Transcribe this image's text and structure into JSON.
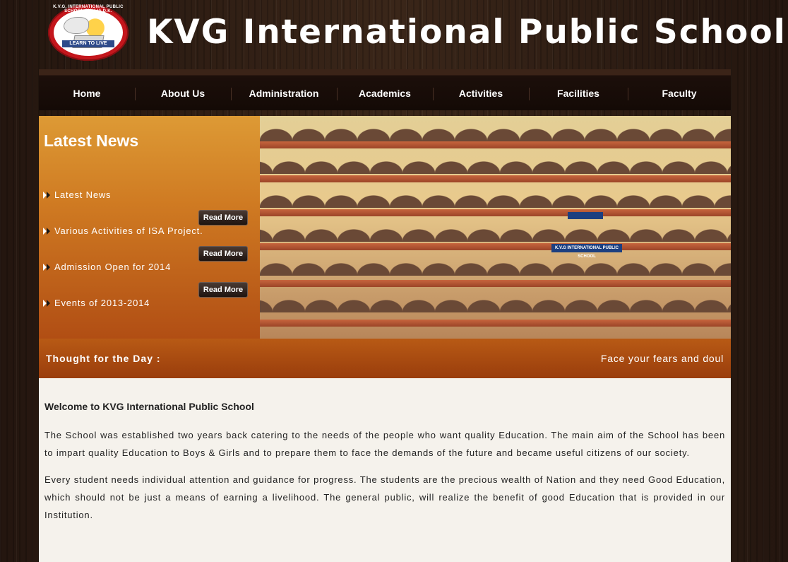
{
  "header": {
    "site_title": "KVG International Public School",
    "logo": {
      "ring_text": "K.V.G. INTERNATIONAL PUBLIC SCHOOL SULLIA D.K.",
      "banner_text": "LEARN TO LIVE"
    }
  },
  "nav": {
    "items": [
      "Home",
      "About Us",
      "Administration",
      "Academics",
      "Activities",
      "Facilities",
      "Faculty"
    ]
  },
  "news": {
    "title": "Latest News",
    "items": [
      "Latest News",
      "Various Activities of ISA Project.",
      "Admission Open for 2014",
      "Events of 2013-2014"
    ],
    "read_more_label": "Read More"
  },
  "photo": {
    "sign_text": "K.V.G INTERNATIONAL PUBLIC SCHOOL"
  },
  "thought": {
    "label": "Thought for the Day :",
    "text": "Face your fears and doul"
  },
  "content": {
    "heading": "Welcome to KVG International Public School",
    "paragraphs": [
      "The School was established two years back catering to the needs of the people who want quality Education. The main aim of the School has been to impart quality Education to Boys & Girls and to prepare them to face the demands of the future and became useful citizens of our society.",
      "Every student needs individual attention and guidance for progress. The students are the precious wealth of Nation and they need Good Education, which should not be just a means of earning a livelihood. The general public, will realize the benefit of good Education that is provided in our Institution."
    ]
  },
  "colors": {
    "nav_background": "#140a06",
    "news_panel": "#cf7a22",
    "thought_bar": "#a8470f",
    "content_background": "#f5f2ec"
  }
}
